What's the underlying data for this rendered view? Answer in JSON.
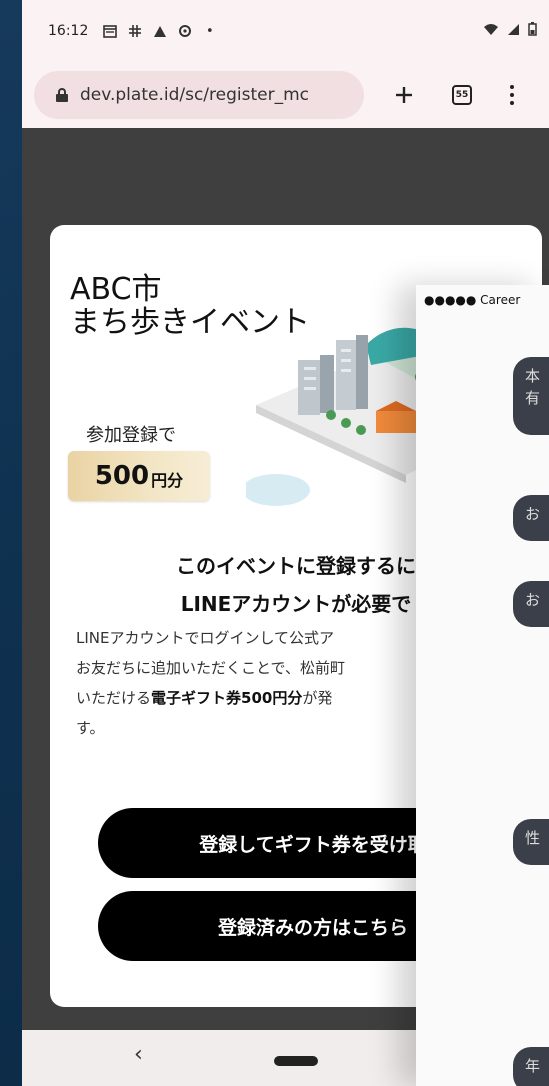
{
  "status_bar": {
    "time": "16:12",
    "notif_icons": [
      "document-icon",
      "grid-icon",
      "warning-icon",
      "sync-icon"
    ],
    "dot": "•"
  },
  "browser": {
    "url": "dev.plate.id/sc/register_mc",
    "tab_count": "55"
  },
  "card": {
    "title_line1": "ABC市",
    "title_line2": "まち歩きイベント",
    "register_label": "参加登録で",
    "amount_number": "500",
    "amount_unit": "円分",
    "headline_line1": "このイベントに登録するに",
    "headline_line2": "LINEアカウントが必要で",
    "body_lines": [
      "LINEアカウントでログインして公式ア",
      "お友だちに追加いただくことで、松前町",
      "いただける",
      "電子ギフト券500円分",
      "が発",
      "す。"
    ],
    "primary_button": "登録してギフト券を受け取",
    "secondary_button": "登録済みの方はこちら"
  },
  "nav": {
    "back": "‹"
  },
  "overlay": {
    "status": "●●●●● Career",
    "bubbles": [
      "本\n有",
      "お",
      "お",
      "性",
      "年"
    ]
  },
  "colors": {
    "background": "#0f3150",
    "button": "#000000",
    "badge": "#e9d3a3",
    "chat_bubble": "#3b3f4a"
  }
}
